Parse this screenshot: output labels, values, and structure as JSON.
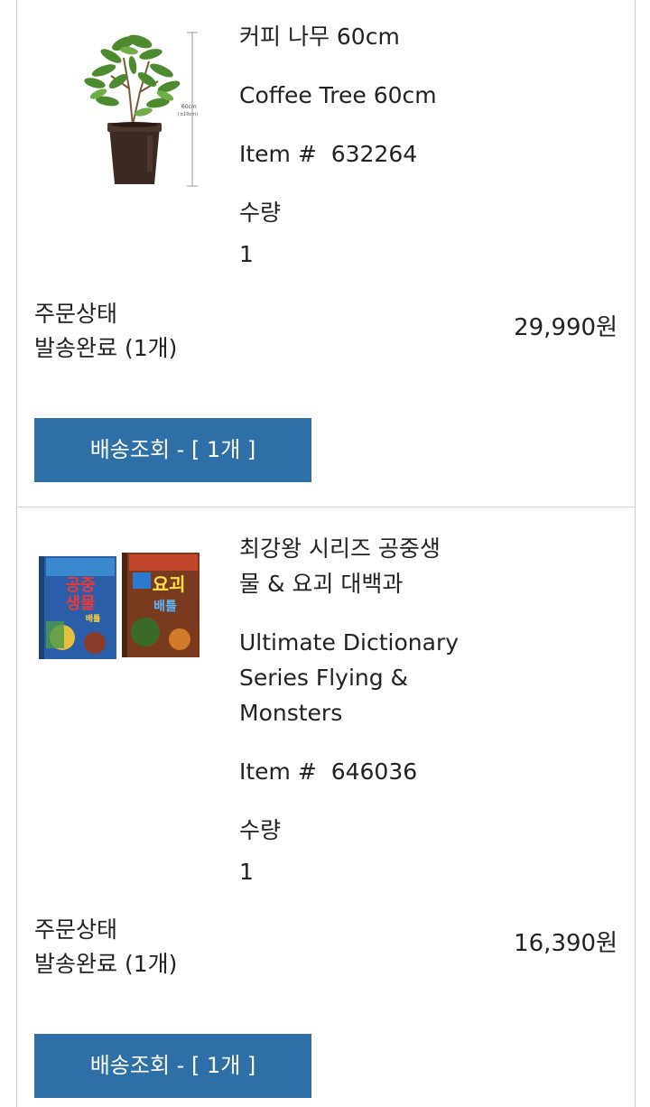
{
  "orders": [
    {
      "name_ko": "커피 나무 60cm",
      "name_en": "Coffee Tree 60cm",
      "item_label": "Item #",
      "item_no": "632264",
      "qty_label": "수량",
      "qty": "1",
      "status_label": "주문상태",
      "status_value": "발송완료 (1개)",
      "price": "29,990원",
      "track_button": "배송조회 - [ 1개 ]",
      "image_text": [
        "60cm",
        "(±10cm)"
      ]
    },
    {
      "name_ko_l1": "최강왕 시리즈 공중생",
      "name_ko_l2": "물 & 요괴 대백과",
      "name_en_l1": "Ultimate Dictionary",
      "name_en_l2": "Series Flying &",
      "name_en_l3": "Monsters",
      "item_label": "Item #",
      "item_no": "646036",
      "qty_label": "수량",
      "qty": "1",
      "status_label": "주문상태",
      "status_value": "발송완료 (1개)",
      "price": "16,390원",
      "track_button": "배송조회 - [ 1개 ]",
      "image_text": [
        "공중",
        "생물",
        "배틀",
        "요괴",
        "배틀"
      ]
    }
  ],
  "colors": {
    "button": "#2f6fa8",
    "border": "#cfcfcf",
    "text": "#222222"
  },
  "icons": [
    "coffee-tree-product-image",
    "book-set-product-image"
  ]
}
